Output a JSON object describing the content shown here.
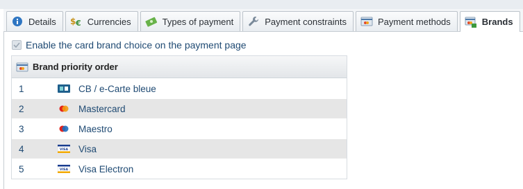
{
  "tabs": [
    {
      "label": "Details",
      "icon": "info-icon"
    },
    {
      "label": "Currencies",
      "icon": "currency-icon"
    },
    {
      "label": "Types of payment",
      "icon": "banknote-icon"
    },
    {
      "label": "Payment constraints",
      "icon": "wrench-icon"
    },
    {
      "label": "Payment methods",
      "icon": "card-icon"
    },
    {
      "label": "Brands",
      "icon": "brands-icon",
      "active": true
    }
  ],
  "checkbox": {
    "label": "Enable the card brand choice on the payment page",
    "checked": true
  },
  "table": {
    "header": "Brand priority order",
    "rows": [
      {
        "num": "1",
        "name": "CB / e-Carte bleue",
        "icon": "cb-card-icon"
      },
      {
        "num": "2",
        "name": "Mastercard",
        "icon": "mastercard-icon"
      },
      {
        "num": "3",
        "name": "Maestro",
        "icon": "maestro-icon"
      },
      {
        "num": "4",
        "name": "Visa",
        "icon": "visa-icon"
      },
      {
        "num": "5",
        "name": "Visa Electron",
        "icon": "visa-icon"
      }
    ]
  },
  "colors": {
    "link": "#1f4a73",
    "alt_row": "#e6e6e6",
    "info_blue": "#2f76c2"
  }
}
